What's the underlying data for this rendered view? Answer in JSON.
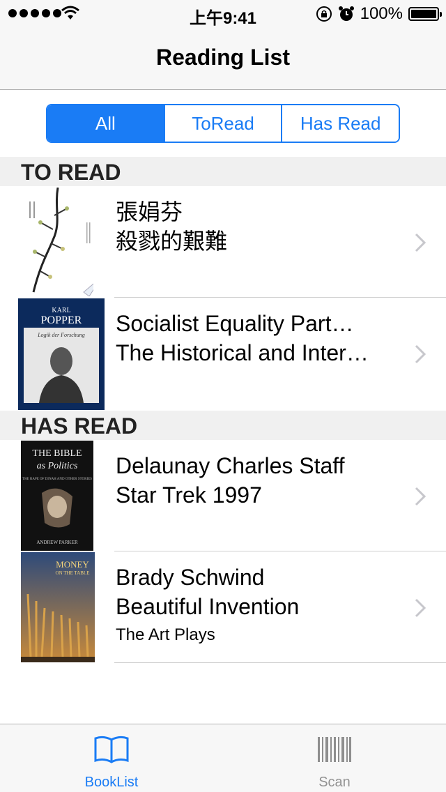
{
  "status_bar": {
    "time": "上午9:41",
    "battery": "100%"
  },
  "nav": {
    "title": "Reading List"
  },
  "segments": [
    {
      "label": "All",
      "selected": true
    },
    {
      "label": "ToRead",
      "selected": false
    },
    {
      "label": "Has Read",
      "selected": false
    }
  ],
  "sections": [
    {
      "title": "TO READ",
      "rows": [
        {
          "line1": "張娟芬",
          "line2": "殺戮的艱難",
          "line3": ""
        },
        {
          "line1": "Socialist Equality Part…",
          "line2": "The Historical and Inter…",
          "line3": ""
        }
      ]
    },
    {
      "title": "HAS READ",
      "rows": [
        {
          "line1": "Delaunay Charles Staff",
          "line2": "Star Trek 1997",
          "line3": ""
        },
        {
          "line1": "Brady Schwind",
          "line2": "Beautiful Invention",
          "line3": "The Art Plays"
        }
      ]
    }
  ],
  "covers": {
    "c2_top": "KARL",
    "c2_name": "POPPER",
    "c2_sub": "Logik der Forschung",
    "c3_title1": "THE BIBLE",
    "c3_title2": "as Politics",
    "c3_sub": "THE RAPE OF DINAH AND OTHER STORIES",
    "c3_author": "ANDREW PARKER",
    "c4_title1": "MONEY",
    "c4_title2": "ON THE TABLE"
  },
  "tabs": [
    {
      "label": "BookList",
      "icon": "book-icon",
      "active": true
    },
    {
      "label": "Scan",
      "icon": "barcode-icon",
      "active": false
    }
  ],
  "colors": {
    "accent": "#1a7cf5",
    "inactive": "#929292"
  }
}
